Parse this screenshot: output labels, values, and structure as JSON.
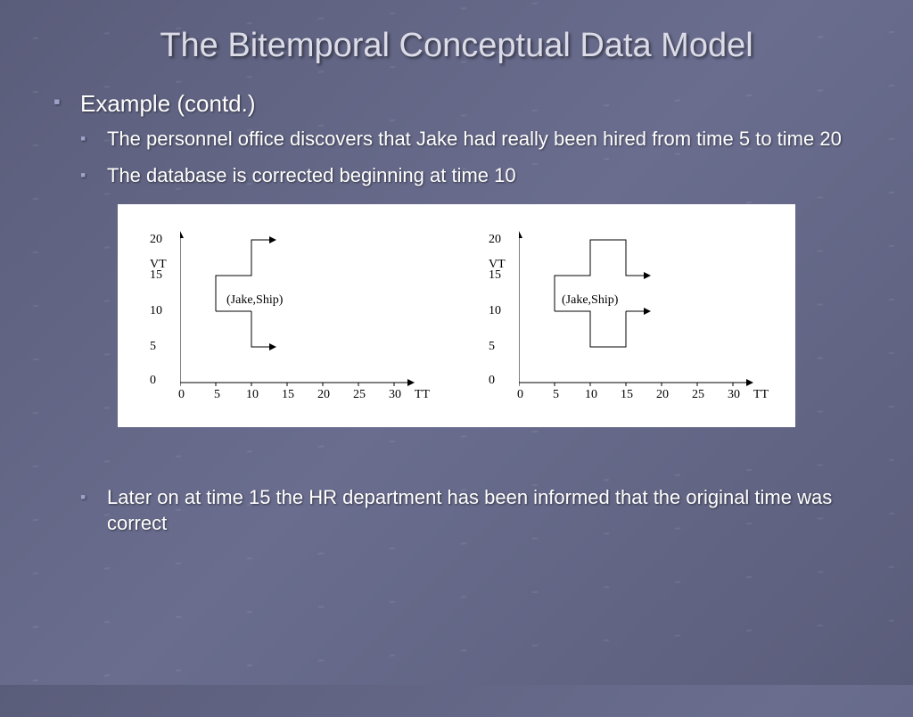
{
  "title": "The Bitemporal Conceptual Data Model",
  "subtitle": "Example (contd.)",
  "bullets": {
    "top": [
      "The personnel office discovers that Jake had really been hired from time 5 to time 20",
      "The database is corrected beginning at time 10"
    ],
    "bottom": [
      "Later on at time 15 the HR department has been informed that the original time was correct"
    ]
  },
  "chart_data": [
    {
      "type": "line",
      "title": "",
      "xlabel": "TT",
      "ylabel": "VT",
      "xlim": [
        0,
        30
      ],
      "ylim": [
        0,
        20
      ],
      "xticks": [
        0,
        5,
        10,
        15,
        20,
        25,
        30
      ],
      "yticks": [
        0,
        5,
        10,
        15,
        20
      ],
      "region_label": "(Jake,Ship)",
      "region_outline": [
        {
          "tt": 5,
          "vt": 10
        },
        {
          "tt": 5,
          "vt": 15
        },
        {
          "tt": 10,
          "vt": 15
        },
        {
          "tt": 10,
          "vt": 20
        },
        {
          "tt": "→",
          "vt": 20
        },
        {
          "tt": 10,
          "vt": 5
        },
        {
          "tt": "→",
          "vt": 5
        }
      ]
    },
    {
      "type": "line",
      "title": "",
      "xlabel": "TT",
      "ylabel": "VT",
      "xlim": [
        0,
        30
      ],
      "ylim": [
        0,
        20
      ],
      "xticks": [
        0,
        5,
        10,
        15,
        20,
        25,
        30
      ],
      "yticks": [
        0,
        5,
        10,
        15,
        20
      ],
      "region_label": "(Jake,Ship)",
      "region_outline": [
        {
          "tt": 5,
          "vt": 10
        },
        {
          "tt": 5,
          "vt": 15
        },
        {
          "tt": 10,
          "vt": 15
        },
        {
          "tt": 10,
          "vt": 20
        },
        {
          "tt": 15,
          "vt": 20
        },
        {
          "tt": 15,
          "vt": 15
        },
        {
          "tt": "→",
          "vt": 15
        },
        {
          "tt": 15,
          "vt": 10
        },
        {
          "tt": "→",
          "vt": 10
        },
        {
          "tt": 15,
          "vt": 5
        },
        {
          "tt": 10,
          "vt": 5
        },
        {
          "tt": 10,
          "vt": 10
        }
      ]
    }
  ]
}
